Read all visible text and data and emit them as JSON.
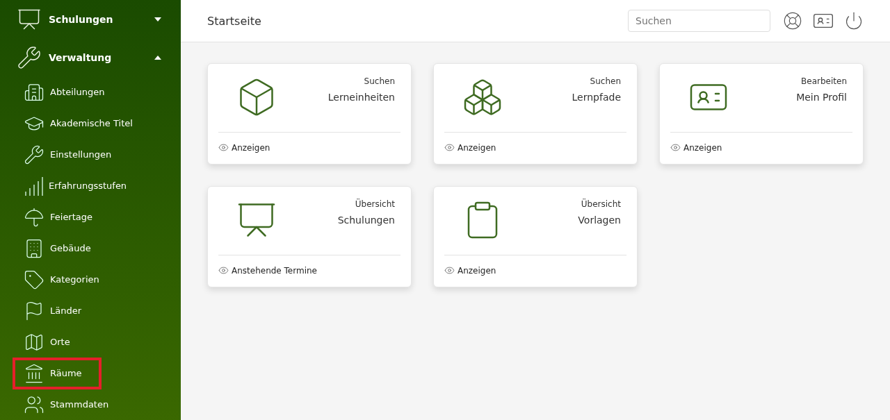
{
  "sidebar": {
    "sections": [
      {
        "label": "Schulungen",
        "expanded": false
      },
      {
        "label": "Verwaltung",
        "expanded": true,
        "children": [
          {
            "label": "Abteilungen",
            "highlighted": false
          },
          {
            "label": "Akademische Titel",
            "highlighted": false
          },
          {
            "label": "Einstellungen",
            "highlighted": false
          },
          {
            "label": "Erfahrungsstufen",
            "highlighted": false
          },
          {
            "label": "Feiertage",
            "highlighted": false
          },
          {
            "label": "Gebäude",
            "highlighted": false
          },
          {
            "label": "Kategorien",
            "highlighted": false
          },
          {
            "label": "Länder",
            "highlighted": false
          },
          {
            "label": "Orte",
            "highlighted": false
          },
          {
            "label": "Räume",
            "highlighted": true
          },
          {
            "label": "Stammdaten",
            "highlighted": false
          }
        ]
      }
    ]
  },
  "header": {
    "title": "Startseite",
    "search": {
      "placeholder": "Suchen"
    }
  },
  "cards": [
    {
      "caption": "Suchen",
      "title": "Lerneinheiten",
      "link": "Anzeigen"
    },
    {
      "caption": "Suchen",
      "title": "Lernpfade",
      "link": "Anzeigen"
    },
    {
      "caption": "Bearbeiten",
      "title": "Mein Profil",
      "link": "Anzeigen"
    },
    {
      "caption": "Übersicht",
      "title": "Schulungen",
      "link": "Anstehende Termine"
    },
    {
      "caption": "Übersicht",
      "title": "Vorlagen",
      "link": "Anzeigen"
    }
  ]
}
